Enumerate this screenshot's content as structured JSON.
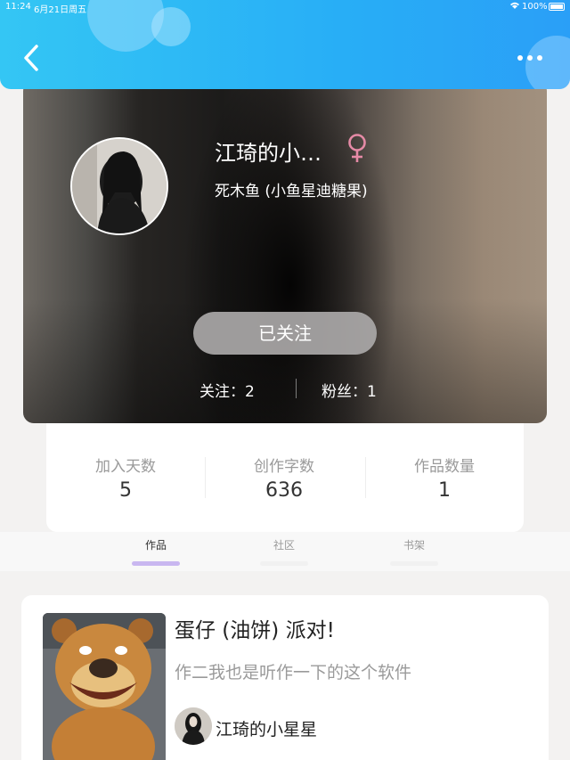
{
  "status_bar": {
    "time": "11:24",
    "date": "6月21日周五",
    "battery": "100%"
  },
  "header": {
    "back_icon": "chevron-left-icon",
    "more_icon": "more-dots-icon",
    "accent_color": "#28aef6"
  },
  "profile": {
    "username": "江琦的小…",
    "gender_icon": "female-icon",
    "gender_color": "#e58aa6",
    "nickname": "死木鱼 (小鱼星迪糖果)",
    "follow_button": "已关注",
    "following": "关注：2",
    "fans": "粉丝：1"
  },
  "stats": [
    {
      "label": "加入天数",
      "value": "5"
    },
    {
      "label": "创作字数",
      "value": "636"
    },
    {
      "label": "作品数量",
      "value": "1"
    }
  ],
  "tabs": [
    {
      "label": "作品",
      "active": true
    },
    {
      "label": "社区",
      "active": false
    },
    {
      "label": "书架",
      "active": false
    }
  ],
  "work": {
    "title": "蛋仔 (油饼) 派对!",
    "description": "作二我也是听作一下的这个软件",
    "author": "江琦的小星星"
  }
}
